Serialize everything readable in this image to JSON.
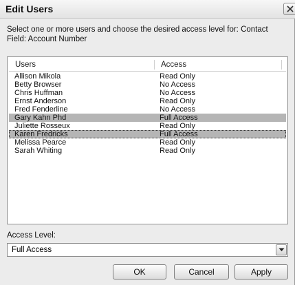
{
  "window": {
    "title": "Edit Users",
    "close_icon": "close-icon"
  },
  "instructions": "Select one or more users and choose the desired access level for:  Contact Field: Account Number",
  "list": {
    "columns": [
      "Users",
      "Access"
    ],
    "rows": [
      {
        "user": "Allison Mikola",
        "access": "Read Only",
        "selected": false
      },
      {
        "user": "Betty Browser",
        "access": "No Access",
        "selected": false
      },
      {
        "user": "Chris Huffman",
        "access": "No Access",
        "selected": false
      },
      {
        "user": "Ernst Anderson",
        "access": "Read Only",
        "selected": false
      },
      {
        "user": "Fred Fenderline",
        "access": "No Access",
        "selected": false
      },
      {
        "user": "Gary Kahn Phd",
        "access": "Full Access",
        "selected": true
      },
      {
        "user": "Juliette Rosseux",
        "access": "Read Only",
        "selected": false
      },
      {
        "user": "Karen Fredricks",
        "access": "Full Access",
        "selected": true
      },
      {
        "user": "Melissa Pearce",
        "access": "Read Only",
        "selected": false
      },
      {
        "user": "Sarah Whiting",
        "access": "Read Only",
        "selected": false
      }
    ],
    "selection_color": "#b5b5b5"
  },
  "access_level": {
    "label": "Access Level:",
    "value": "Full Access",
    "dropdown_icon": "chevron-down-icon"
  },
  "buttons": {
    "ok": "OK",
    "cancel": "Cancel",
    "apply": "Apply"
  }
}
